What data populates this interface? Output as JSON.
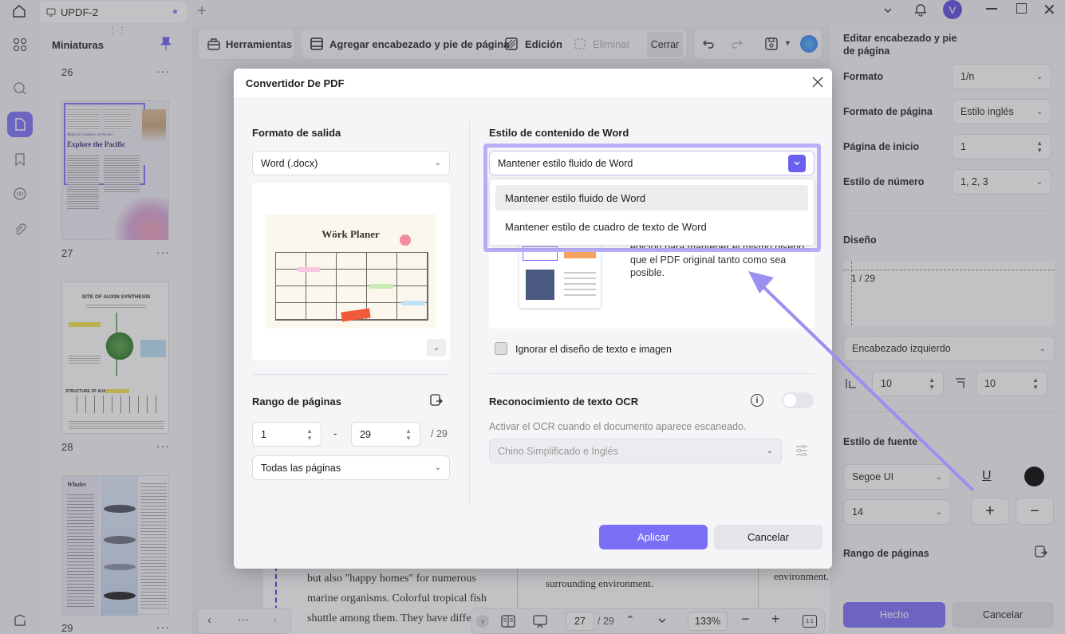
{
  "titlebar": {
    "tab_title": "UPDF-2",
    "avatar_letter": "V"
  },
  "thumbnails": {
    "title": "Miniaturas",
    "pages": [
      "26",
      "27",
      "28",
      "29"
    ],
    "page27": {
      "line1": "Magical creatures of the sea",
      "line2": "Explore the Pacific"
    },
    "page28": {
      "title": "SITE OF AUXIN SYNTHESIS",
      "sub": "STRUCTURE OF AUXIN"
    },
    "page29": {
      "title": "Whales"
    }
  },
  "toolbar": {
    "tools_label": "Herramientas",
    "header_footer_label": "Agregar encabezado y pie de página",
    "edit_label": "Edición",
    "delete_label": "Eliminar",
    "close_label": "Cerrar"
  },
  "document": {
    "left_lines": [
      "but also \"happy homes\" for numerous",
      "marine organisms. Colorful tropical fish",
      "shuttle among them. They have differe"
    ],
    "middle_line": "surrounding environment.",
    "right_line": "environment."
  },
  "bottombar": {
    "page_current": "27",
    "page_total": "/ 29",
    "zoom": "133%"
  },
  "right_panel": {
    "title": "Editar encabezado y pie de página",
    "format_label": "Formato",
    "format_value": "1/n",
    "page_format_label": "Formato de página",
    "page_format_value": "Estilo inglés",
    "start_page_label": "Página de inicio",
    "start_page_value": "1",
    "number_style_label": "Estilo de número",
    "number_style_value": "1, 2, 3",
    "design_label": "Diseño",
    "design_preview": "1 / 29",
    "position_value": "Encabezado izquierdo",
    "margin_left": "10",
    "margin_top": "10",
    "font_style_label": "Estilo de fuente",
    "font_value": "Segoe UI",
    "font_size": "14",
    "font_color": "#000000",
    "page_range_label": "Rango de páginas",
    "done_label": "Hecho",
    "cancel_label": "Cancelar"
  },
  "dialog": {
    "title": "Convertidor De PDF",
    "output_format_label": "Formato de salida",
    "output_format_value": "Word (.docx)",
    "preview_title": "Wörk Planer",
    "page_range_label": "Rango de páginas",
    "range_from": "1",
    "range_dash": "-",
    "range_to": "29",
    "range_total": "/ 29",
    "range_option": "Todas las páginas",
    "word_style_label": "Estilo de contenido de Word",
    "word_style_value": "Mantener estilo fluido de Word",
    "word_style_options": [
      "Mantener estilo fluido de Word",
      "Mantener estilo de cuadro de texto de Word"
    ],
    "description": "edición para mantener el mismo diseño que el PDF original tanto como sea posible.",
    "ignore_layout_label": "Ignorar el diseño de texto e imagen",
    "ocr_label": "Reconocimiento de texto OCR",
    "ocr_hint": "Activar el OCR cuando el documento aparece escaneado.",
    "ocr_language": "Chino Simplificado e Inglés",
    "apply_label": "Aplicar",
    "cancel_label": "Cancelar"
  },
  "colors": {
    "accent": "#7b6ff7",
    "highlight": "#b9aef8"
  }
}
